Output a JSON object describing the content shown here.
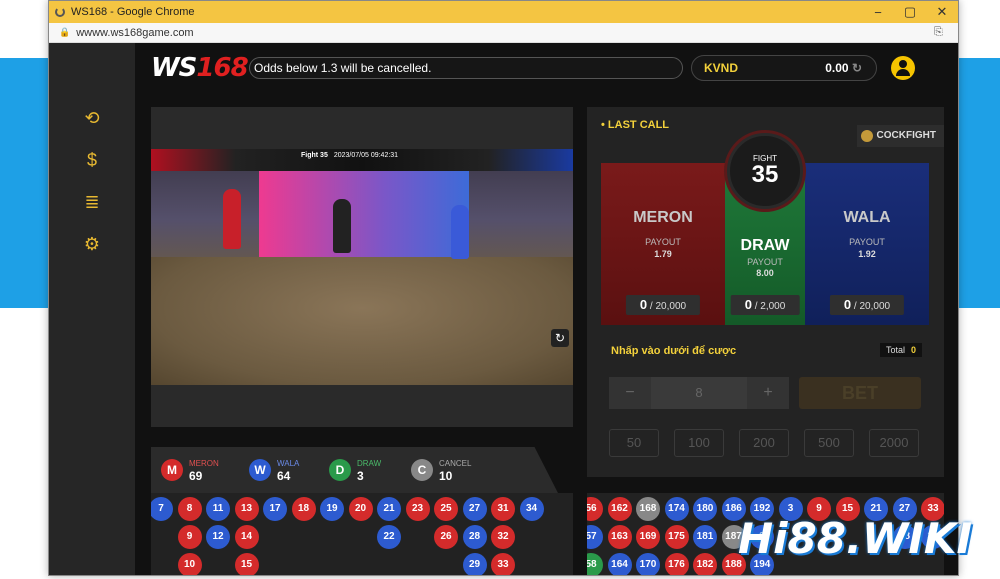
{
  "browser": {
    "window_title": "WS168 - Google Chrome",
    "url": "wwww.ws168game.com",
    "translate_icon": "translate-icon"
  },
  "sidebar": {
    "items": [
      {
        "name": "history-icon",
        "glyph": "⟲"
      },
      {
        "name": "money-doc-icon",
        "glyph": "$"
      },
      {
        "name": "report-icon",
        "glyph": "≣"
      },
      {
        "name": "settings-icon",
        "glyph": "⚙"
      }
    ]
  },
  "header": {
    "logo_a": "WS",
    "logo_b": "168",
    "notice": "Odds below 1.3 will be cancelled.",
    "currency": "KVND",
    "balance": "0.00"
  },
  "video": {
    "fight_label": "Fight 35",
    "timestamp": "2023/07/05 09:42:31"
  },
  "bet": {
    "last_call": "LAST CALL",
    "game": "COCKFIGHT",
    "fight_label": "FIGHT",
    "fight_no": "35",
    "meron": {
      "name": "MERON",
      "payout_label": "PAYOUT",
      "payout": "1.79",
      "pool_bet": "0",
      "pool_max": "/ 20,000"
    },
    "draw": {
      "name": "DRAW",
      "payout_label": "PAYOUT",
      "payout": "8.00",
      "pool_bet": "0",
      "pool_max": "/ 2,000"
    },
    "wala": {
      "name": "WALA",
      "payout_label": "PAYOUT",
      "payout": "1.92",
      "pool_bet": "0",
      "pool_max": "/ 20,000"
    },
    "prompt": "Nhấp vào dưới để cược",
    "total_label": "Total",
    "total_value": "0",
    "minus": "−",
    "amount": "8",
    "plus": "+",
    "bet_label": "BET",
    "chips": [
      "50",
      "100",
      "200",
      "500",
      "2000"
    ]
  },
  "stats": [
    {
      "badge": "M",
      "label": "MERON",
      "count": "69",
      "color": "#d42b2b"
    },
    {
      "badge": "W",
      "label": "WALA",
      "count": "64",
      "color": "#2d5bd0"
    },
    {
      "badge": "D",
      "label": "DRAW",
      "count": "3",
      "color": "#2a9a4a"
    },
    {
      "badge": "C",
      "label": "CANCEL",
      "count": "10",
      "color": "#888888"
    }
  ],
  "road_left": [
    [
      {
        "n": "7",
        "c": "b"
      }
    ],
    [
      {
        "n": "8",
        "c": "r"
      },
      {
        "n": "9",
        "c": "r"
      },
      {
        "n": "10",
        "c": "r"
      }
    ],
    [
      {
        "n": "11",
        "c": "b"
      },
      {
        "n": "12",
        "c": "b"
      }
    ],
    [
      {
        "n": "13",
        "c": "r"
      },
      {
        "n": "14",
        "c": "r"
      },
      {
        "n": "15",
        "c": "r"
      }
    ],
    [
      {
        "n": "17",
        "c": "b"
      }
    ],
    [
      {
        "n": "18",
        "c": "r"
      }
    ],
    [
      {
        "n": "19",
        "c": "b"
      }
    ],
    [
      {
        "n": "20",
        "c": "r"
      }
    ],
    [
      {
        "n": "21",
        "c": "b"
      },
      {
        "n": "22",
        "c": "b"
      }
    ],
    [
      {
        "n": "23",
        "c": "r"
      }
    ],
    [
      {
        "n": "25",
        "c": "r"
      },
      {
        "n": "26",
        "c": "r"
      }
    ],
    [
      {
        "n": "27",
        "c": "b"
      },
      {
        "n": "28",
        "c": "b"
      },
      {
        "n": "29",
        "c": "b"
      }
    ],
    [
      {
        "n": "31",
        "c": "r"
      },
      {
        "n": "32",
        "c": "r"
      },
      {
        "n": "33",
        "c": "r"
      }
    ],
    [
      {
        "n": "34",
        "c": "b"
      }
    ]
  ],
  "road_right": [
    [
      {
        "n": "56",
        "c": "r"
      },
      {
        "n": "57",
        "c": "b"
      },
      {
        "n": "58",
        "c": "d"
      }
    ],
    [
      {
        "n": "162",
        "c": "r"
      },
      {
        "n": "163",
        "c": "r"
      },
      {
        "n": "164",
        "c": "b"
      }
    ],
    [
      {
        "n": "168",
        "c": "g"
      },
      {
        "n": "169",
        "c": "r"
      },
      {
        "n": "170",
        "c": "b"
      }
    ],
    [
      {
        "n": "174",
        "c": "b"
      },
      {
        "n": "175",
        "c": "r"
      },
      {
        "n": "176",
        "c": "r"
      }
    ],
    [
      {
        "n": "180",
        "c": "b"
      },
      {
        "n": "181",
        "c": "b"
      },
      {
        "n": "182",
        "c": "r"
      }
    ],
    [
      {
        "n": "186",
        "c": "b"
      },
      {
        "n": "187",
        "c": "g"
      },
      {
        "n": "188",
        "c": "r"
      }
    ],
    [
      {
        "n": "192",
        "c": "b"
      },
      {
        "n": "3",
        "c": "b"
      },
      {
        "n": "194",
        "c": "b"
      }
    ],
    [
      {
        "n": "3",
        "c": "b"
      }
    ],
    [
      {
        "n": "9",
        "c": "r"
      }
    ],
    [
      {
        "n": "15",
        "c": "r"
      }
    ],
    [
      {
        "n": "21",
        "c": "b"
      }
    ],
    [
      {
        "n": "27",
        "c": "b"
      },
      {
        "n": "28",
        "c": "b"
      }
    ],
    [
      {
        "n": "33",
        "c": "r"
      },
      {
        "n": "34",
        "c": "b"
      }
    ]
  ],
  "watermark": "Hi88.WIKI"
}
